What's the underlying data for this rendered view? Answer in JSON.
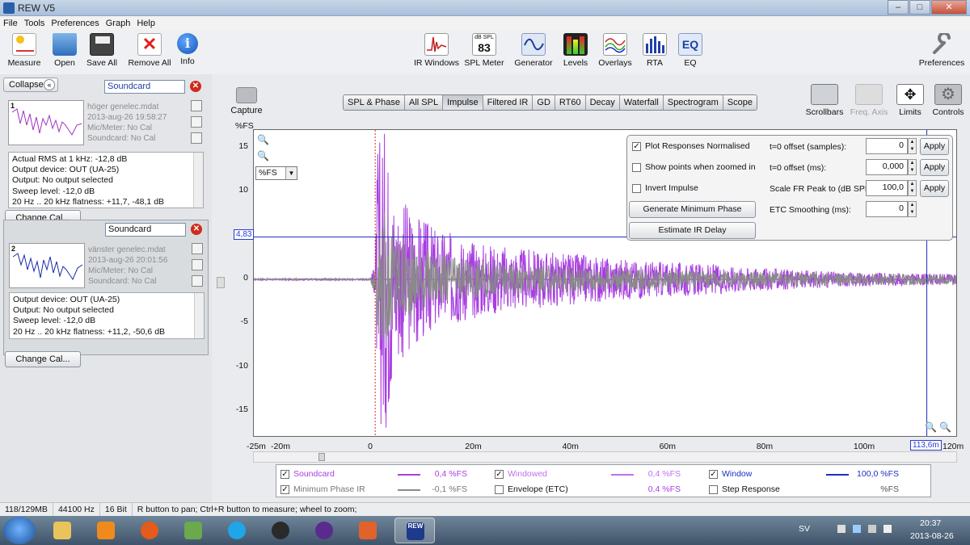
{
  "window": {
    "title": "REW V5"
  },
  "menu": [
    "File",
    "Tools",
    "Preferences",
    "Graph",
    "Help"
  ],
  "toolbar": {
    "left": [
      "Measure",
      "Open",
      "Save All",
      "Remove All",
      "Info"
    ],
    "center": [
      "IR Windows",
      "SPL Meter",
      "Generator",
      "Levels",
      "Overlays",
      "RTA",
      "EQ"
    ],
    "spl_meter_value": "83",
    "spl_meter_unit": "dB SPL",
    "eq_icon_text": "EQ",
    "right": [
      "Preferences"
    ]
  },
  "left_panel": {
    "collapse_label": "Collapse",
    "measurements": [
      {
        "index": "1",
        "name": "Soundcard",
        "file": "höger genelec.mdat",
        "date": "2013-aug-26 19:58:27",
        "mic": "Mic/Meter: No Cal",
        "soundcard": "Soundcard: No Cal",
        "info": [
          "Actual RMS at 1 kHz: -12,8 dB",
          "Output device: OUT (UA-25)",
          "Output: No output selected",
          "Sweep level: -12,0 dB",
          "20 Hz .. 20 kHz flatness: +11,7, -48,1 dB"
        ],
        "change_cal": "Change Cal...",
        "trace_color": "#a033c4"
      },
      {
        "index": "2",
        "name": "Soundcard",
        "file": "vänster genelec.mdat",
        "date": "2013-aug-26 20:01:56",
        "mic": "Mic/Meter: No Cal",
        "soundcard": "Soundcard: No Cal",
        "info": [
          "Output device: OUT (UA-25)",
          "Output: No output selected",
          "Sweep level: -12,0 dB",
          "20 Hz .. 20 kHz flatness: +11,2, -50,6 dB"
        ],
        "change_cal": "Change Cal...",
        "trace_color": "#1a2aa8"
      }
    ]
  },
  "graph": {
    "capture_label": "Capture",
    "tabs": [
      "SPL & Phase",
      "All SPL",
      "Impulse",
      "Filtered IR",
      "GD",
      "RT60",
      "Decay",
      "Waterfall",
      "Spectrogram",
      "Scope"
    ],
    "active_tab": "Impulse",
    "right_tools": [
      "Scrollbars",
      "Freq. Axis",
      "Limits",
      "Controls"
    ],
    "y_unit": "%FS",
    "unit_select": "%FS",
    "cursor_y": "4,83",
    "cursor_x": "113,6m",
    "x_unit": "s",
    "chart_data": {
      "type": "line",
      "title": "",
      "xlabel": "s",
      "ylabel": "%FS",
      "xlim": [
        -0.025,
        0.12
      ],
      "ylim": [
        -18,
        17
      ],
      "x_ticks": [
        "-25m",
        "-20m",
        "0",
        "20m",
        "40m",
        "60m",
        "80m",
        "100m",
        "120m"
      ],
      "x_tick_values": [
        -0.025,
        -0.02,
        0,
        0.02,
        0.04,
        0.06,
        0.08,
        0.1,
        0.12
      ],
      "y_ticks": [
        "15",
        "10",
        "5",
        "0",
        "-5",
        "-10",
        "-15"
      ],
      "y_tick_values": [
        15,
        10,
        5,
        0,
        -5,
        -10,
        -15
      ],
      "grid": false,
      "series": [
        {
          "name": "Soundcard",
          "color": "#a83ee0",
          "envelope": [
            [
              -0.025,
              0.1
            ],
            [
              -0.001,
              0.1
            ],
            [
              0,
              2.0
            ],
            [
              0.0005,
              16.0
            ],
            [
              0.002,
              18.0
            ],
            [
              0.004,
              10.0
            ],
            [
              0.008,
              8.0
            ],
            [
              0.012,
              6.0
            ],
            [
              0.02,
              4.5
            ],
            [
              0.03,
              3.5
            ],
            [
              0.04,
              3.0
            ],
            [
              0.05,
              2.4
            ],
            [
              0.06,
              2.0
            ],
            [
              0.07,
              1.7
            ],
            [
              0.08,
              1.3
            ],
            [
              0.09,
              1.0
            ],
            [
              0.1,
              0.8
            ],
            [
              0.12,
              0.6
            ]
          ]
        },
        {
          "name": "Minimum Phase IR",
          "color": "#8a8a8a",
          "envelope": [
            [
              -0.025,
              0.1
            ],
            [
              -0.001,
              0.1
            ],
            [
              0,
              2.0
            ],
            [
              0.0005,
              6.0
            ],
            [
              0.002,
              8.0
            ],
            [
              0.004,
              6.0
            ],
            [
              0.008,
              4.0
            ],
            [
              0.012,
              3.0
            ],
            [
              0.02,
              2.2
            ],
            [
              0.03,
              1.8
            ],
            [
              0.04,
              1.5
            ],
            [
              0.05,
              1.3
            ],
            [
              0.06,
              1.1
            ],
            [
              0.07,
              1.0
            ],
            [
              0.08,
              0.9
            ],
            [
              0.09,
              0.8
            ],
            [
              0.1,
              0.7
            ],
            [
              0.12,
              0.6
            ]
          ]
        }
      ],
      "window_start": 0,
      "window_end": 0.1136,
      "cursor_level": 4.83
    }
  },
  "controls": {
    "plot_normalised": "Plot Responses Normalised",
    "show_points": "Show points when zoomed in",
    "invert": "Invert Impulse",
    "gen_min_phase": "Generate Minimum Phase",
    "est_delay": "Estimate IR Delay",
    "t0_samples_label": "t=0 offset (samples):",
    "t0_samples_value": "0",
    "t0_ms_label": "t=0 offset (ms):",
    "t0_ms_value": "0,000",
    "scale_label": "Scale FR Peak to (dB SPL):",
    "scale_value": "100,0",
    "etc_label": "ETC Smoothing (ms):",
    "etc_value": "0",
    "apply": "Apply"
  },
  "legend": {
    "rows": [
      [
        {
          "label": "Soundcard",
          "value": "0,4 %FS",
          "color": "#a83ee0",
          "checked": true
        },
        {
          "label": "Windowed",
          "value": "0,4 %FS",
          "color": "#c070f0",
          "checked": true
        },
        {
          "label": "Window",
          "value": "100,0 %FS",
          "color": "#1d2fc0",
          "checked": true
        }
      ],
      [
        {
          "label": "Minimum Phase IR",
          "value": "-0,1 %FS",
          "color": "#8a8a8a",
          "checked": true
        },
        {
          "label": "Envelope (ETC)",
          "value": "0,4 %FS",
          "color": "",
          "checked": false
        },
        {
          "label": "Step Response",
          "value": "%FS",
          "color": "",
          "checked": false
        }
      ]
    ]
  },
  "status": {
    "memory": "118/129MB",
    "rate": "44100 Hz",
    "bits": "16 Bit",
    "hint": "R button to pan; Ctrl+R button to measure; wheel to zoom;"
  },
  "taskbar": {
    "lang": "SV",
    "time": "20:37",
    "date": "2013-08-26",
    "rew_label": "REW"
  }
}
